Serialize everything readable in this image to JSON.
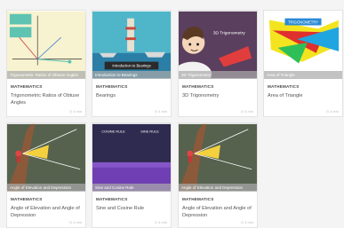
{
  "cards": [
    {
      "subject": "MATHEMATICS",
      "title": "Trigonometric Ratios of Obtuse Angles",
      "caption": "Trigonometric Ratios of Obtuse Angles",
      "meta": "4 min"
    },
    {
      "subject": "MATHEMATICS",
      "title": "Bearings",
      "caption": "Introduction to Bearings",
      "thumb_text": "Introduction to Bearings",
      "meta": "4 min"
    },
    {
      "subject": "MATHEMATICS",
      "title": "3D Trigonometry",
      "caption": "3D Trigonometry",
      "thumb_text": "3D Trigonometry",
      "meta": "4 min"
    },
    {
      "subject": "MATHEMATICS",
      "title": "Area of Triangle",
      "caption": "Area of Triangle",
      "thumb_text": "TRIGONOMETRY",
      "meta": "4 min"
    },
    {
      "subject": "MATHEMATICS",
      "title": "Angle of Elevation and Angle of Depression",
      "caption": "Angle of Elevation and Depression",
      "meta": "4 min"
    },
    {
      "subject": "MATHEMATICS",
      "title": "Sine and Cosine Rule",
      "caption": "Sine and Cosine Rule",
      "thumb_labels": [
        "COSINE RULE",
        "SINE RULE"
      ],
      "meta": "4 min"
    },
    {
      "subject": "MATHEMATICS",
      "title": "Angle of Elevation and Angle of Depression",
      "caption": "Angle of Elevation and Depression",
      "meta": "4 min"
    }
  ],
  "icons": {
    "meta": "clock-icon"
  }
}
